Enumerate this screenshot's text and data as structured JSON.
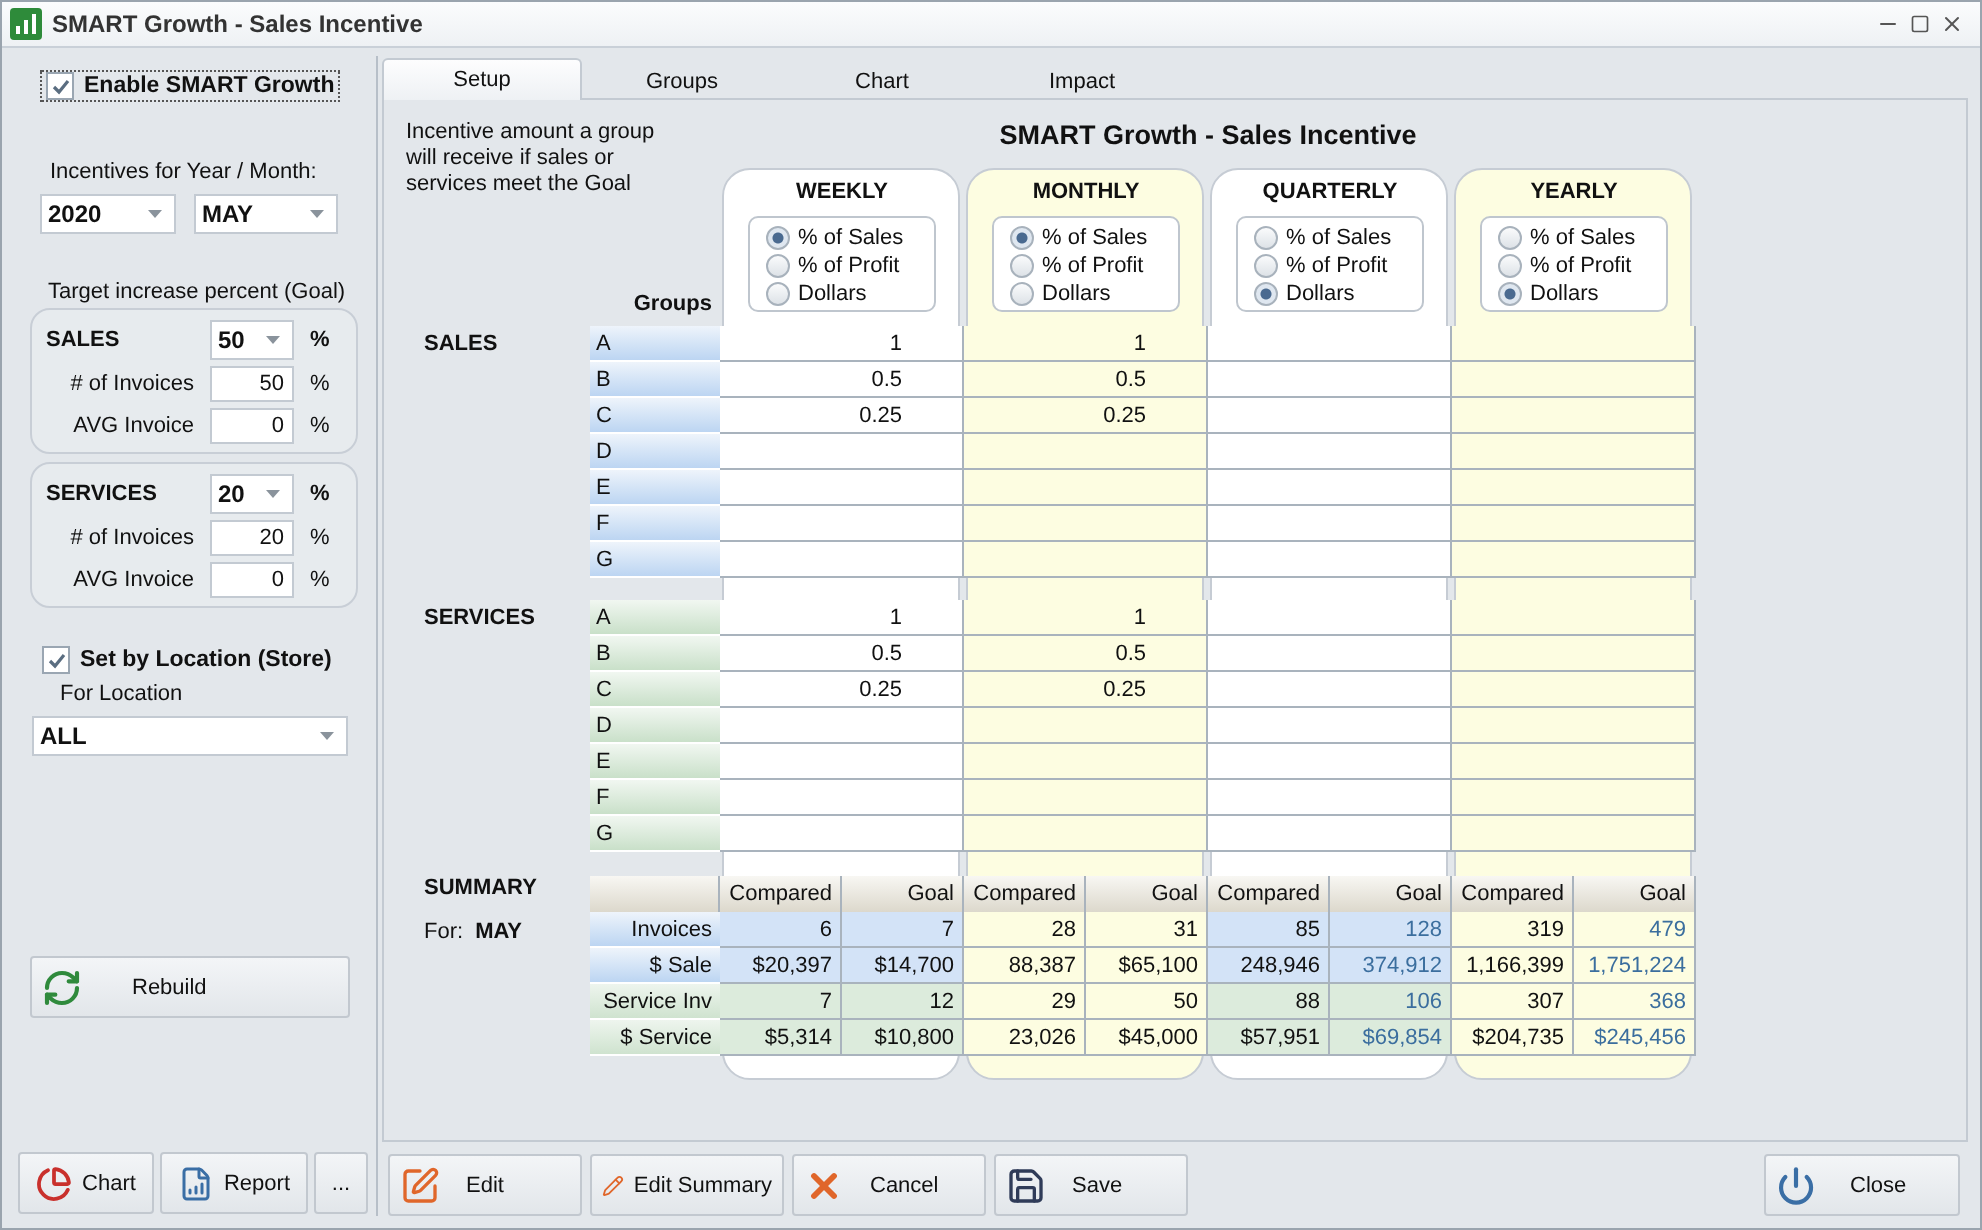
{
  "window": {
    "title": "SMART Growth - Sales Incentive"
  },
  "settings": {
    "enable": {
      "label": "Enable SMART Growth",
      "checked": true
    },
    "period_label": "Incentives for Year / Month:",
    "year": "2020",
    "month": "MAY",
    "goal_label": "Target increase percent (Goal)",
    "goal_groups": [
      {
        "title": "SALES",
        "value": "50",
        "unit": "%",
        "rows": [
          {
            "label": "# of Invoices",
            "value": "50",
            "unit": "%"
          },
          {
            "label": "AVG Invoice",
            "value": "0",
            "unit": "%"
          }
        ]
      },
      {
        "title": "SERVICES",
        "value": "20",
        "unit": "%",
        "rows": [
          {
            "label": "# of Invoices",
            "value": "20",
            "unit": "%"
          },
          {
            "label": "AVG Invoice",
            "value": "0",
            "unit": "%"
          }
        ]
      }
    ],
    "by_location": {
      "label": "Set by Location (Store)",
      "checked": true
    },
    "location_label": "For Location",
    "location": "ALL"
  },
  "rebuild_button": "Rebuild",
  "side_buttons": [
    "Chart",
    "Report",
    "..."
  ],
  "tabs": [
    {
      "label": "Setup",
      "selected": true
    },
    {
      "label": "Groups",
      "selected": false
    },
    {
      "label": "Chart",
      "selected": false
    },
    {
      "label": "Impact",
      "selected": false
    }
  ],
  "description": "Incentive amount a group will receive if sales or services meet the Goal",
  "heading": "SMART Growth - Sales Incentive",
  "groups_label": "Groups",
  "periods": [
    {
      "name": "WEEKLY",
      "kind": "plain",
      "goal_projected": false,
      "options": [
        {
          "label": "% of Sales",
          "selected": true
        },
        {
          "label": "% of Profit",
          "selected": false
        },
        {
          "label": "Dollars",
          "selected": false
        }
      ]
    },
    {
      "name": "MONTHLY",
      "kind": "shaded",
      "goal_projected": false,
      "options": [
        {
          "label": "% of Sales",
          "selected": true
        },
        {
          "label": "% of Profit",
          "selected": false
        },
        {
          "label": "Dollars",
          "selected": false
        }
      ]
    },
    {
      "name": "QUARTERLY",
      "kind": "plain",
      "goal_projected": true,
      "options": [
        {
          "label": "% of Sales",
          "selected": false
        },
        {
          "label": "% of Profit",
          "selected": false
        },
        {
          "label": "Dollars",
          "selected": true
        }
      ]
    },
    {
      "name": "YEARLY",
      "kind": "shaded",
      "goal_projected": true,
      "options": [
        {
          "label": "% of Sales",
          "selected": false
        },
        {
          "label": "% of Profit",
          "selected": false
        },
        {
          "label": "Dollars",
          "selected": true
        }
      ]
    }
  ],
  "sections": [
    {
      "title": "SALES",
      "kind": "sales",
      "rows": [
        {
          "group": "A",
          "values": [
            "1",
            "1"
          ]
        },
        {
          "group": "B",
          "values": [
            "0.5",
            "0.5"
          ]
        },
        {
          "group": "C",
          "values": [
            "0.25",
            "0.25"
          ]
        },
        {
          "group": "D",
          "values": []
        },
        {
          "group": "E",
          "values": []
        },
        {
          "group": "F",
          "values": []
        },
        {
          "group": "G",
          "values": []
        }
      ]
    },
    {
      "title": "SERVICES",
      "kind": "service",
      "rows": [
        {
          "group": "A",
          "values": [
            "1",
            "1"
          ]
        },
        {
          "group": "B",
          "values": [
            "0.5",
            "0.5"
          ]
        },
        {
          "group": "C",
          "values": [
            "0.25",
            "0.25"
          ]
        },
        {
          "group": "D",
          "values": []
        },
        {
          "group": "E",
          "values": []
        },
        {
          "group": "F",
          "values": []
        },
        {
          "group": "G",
          "values": []
        }
      ]
    }
  ],
  "summary": {
    "title": "SUMMARY",
    "for_label": "For:",
    "for_value": "MAY",
    "columns": [
      "Compared",
      "Goal",
      "Compared",
      "Goal",
      "Compared",
      "Goal",
      "Compared",
      "Goal"
    ],
    "rows": [
      {
        "label": "Invoices",
        "kind": "sales",
        "values": [
          "6",
          "7",
          "28",
          "31",
          "85",
          "128",
          "319",
          "479"
        ]
      },
      {
        "label": "$ Sale",
        "kind": "sales",
        "values": [
          "$20,397",
          "$14,700",
          "88,387",
          "$65,100",
          "248,946",
          "374,912",
          "1,166,399",
          "1,751,224"
        ]
      },
      {
        "label": "Service Inv",
        "kind": "service",
        "values": [
          "7",
          "12",
          "29",
          "50",
          "88",
          "106",
          "307",
          "368"
        ]
      },
      {
        "label": "$ Service",
        "kind": "service",
        "values": [
          "$5,314",
          "$10,800",
          "23,026",
          "$45,000",
          "$57,951",
          "$69,854",
          "$204,735",
          "$245,456"
        ]
      }
    ]
  },
  "actions": [
    "Edit",
    "Edit Summary",
    "Cancel",
    "Save"
  ],
  "close_button": "Close"
}
